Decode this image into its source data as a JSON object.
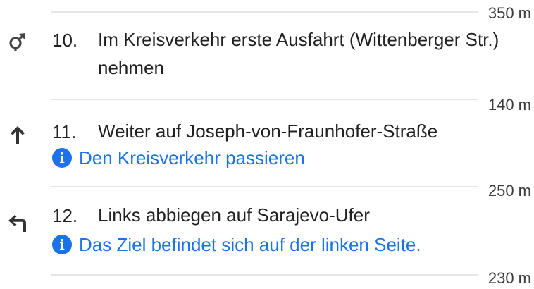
{
  "distances": [
    "350 m",
    "140 m",
    "250 m",
    "230 m"
  ],
  "steps": [
    {
      "number": "10.",
      "icon": "roundabout-first-exit-icon",
      "text": "Im Kreisverkehr erste Ausfahrt (Wittenberger Str.) nehmen"
    },
    {
      "number": "11.",
      "icon": "arrow-straight-icon",
      "text": "Weiter auf Joseph-von-Fraunhofer-Straße",
      "note": "Den Kreisverkehr passieren",
      "note_icon": "info-icon"
    },
    {
      "number": "12.",
      "icon": "turn-left-icon",
      "text": "Links abbiegen auf Sarajevo-Ufer",
      "note": "Das Ziel befindet sich auf der linken Seite.",
      "note_icon": "info-icon"
    }
  ],
  "colors": {
    "link": "#1a73e8",
    "text": "#212121",
    "divider": "#e6e6e6"
  }
}
